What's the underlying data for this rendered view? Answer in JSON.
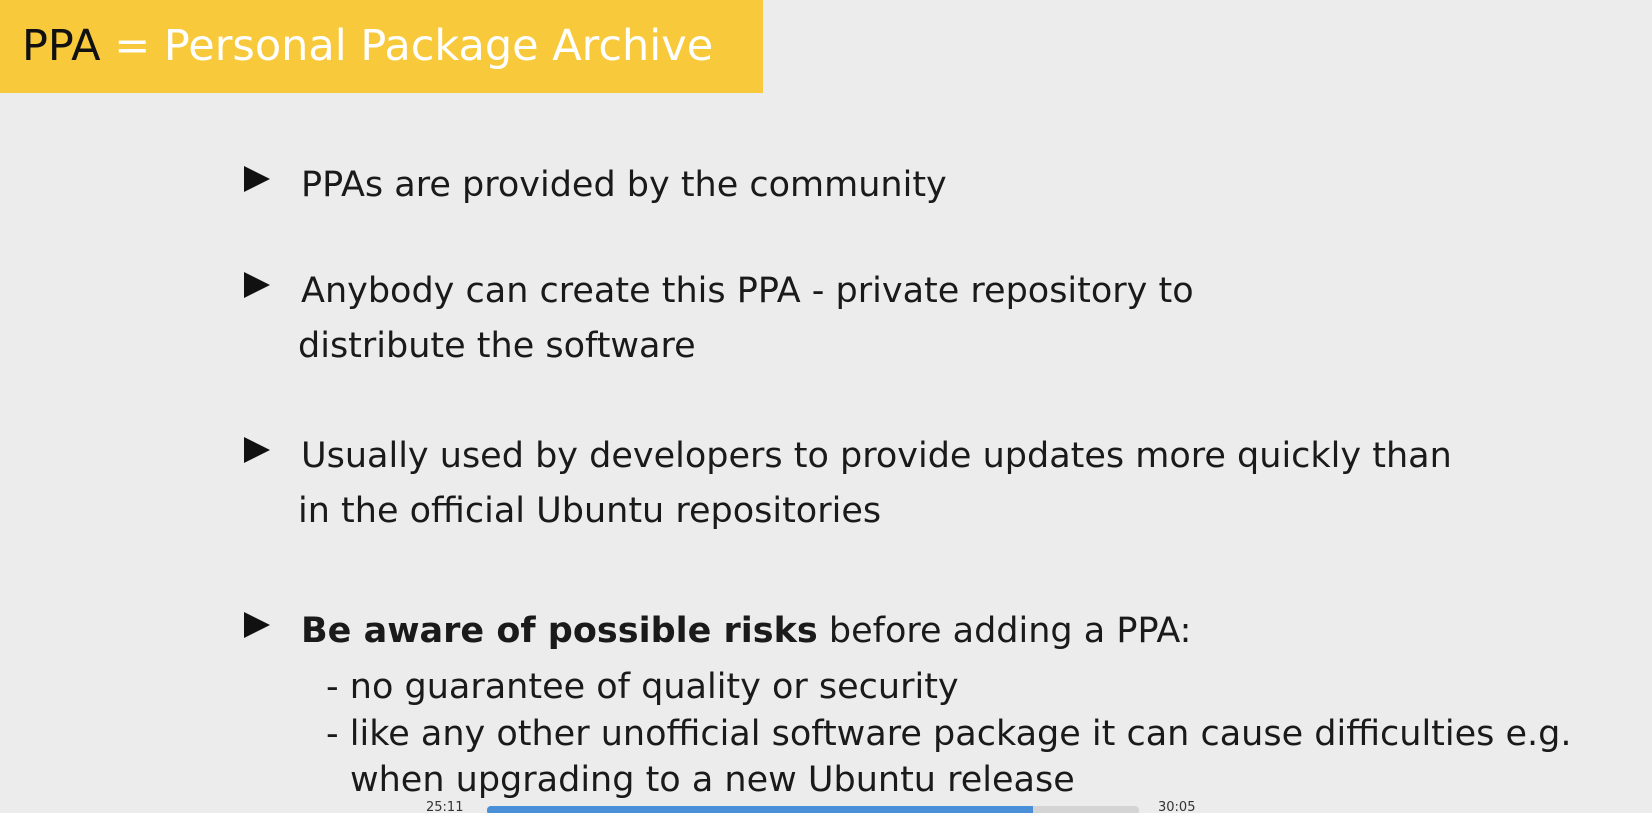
{
  "slide": {
    "title_abbr": "PPA",
    "title_rest": "= Personal Package Archive",
    "bullets": [
      {
        "line1": "PPAs are provided by the community",
        "line2": ""
      },
      {
        "line1": "Anybody can create this PPA - private repository to",
        "line2": "distribute the software"
      },
      {
        "line1": "Usually used by developers to provide updates more quickly than",
        "line2": "in the official Ubuntu repositories"
      },
      {
        "bold": "Be aware of possible risks",
        "rest": " before adding a PPA:"
      }
    ],
    "sub_items": [
      {
        "line1": "- no guarantee of quality or security"
      },
      {
        "line1": "- like any other unofficial software package it can cause difficulties e.g.",
        "line2": "when upgrading to a new Ubuntu release"
      }
    ]
  },
  "player": {
    "current_time": "25:11",
    "total_time": "30:05",
    "progress": 0.837
  },
  "colors": {
    "title_bar": "#f8c93a",
    "progress_fill": "#4a90d9"
  }
}
